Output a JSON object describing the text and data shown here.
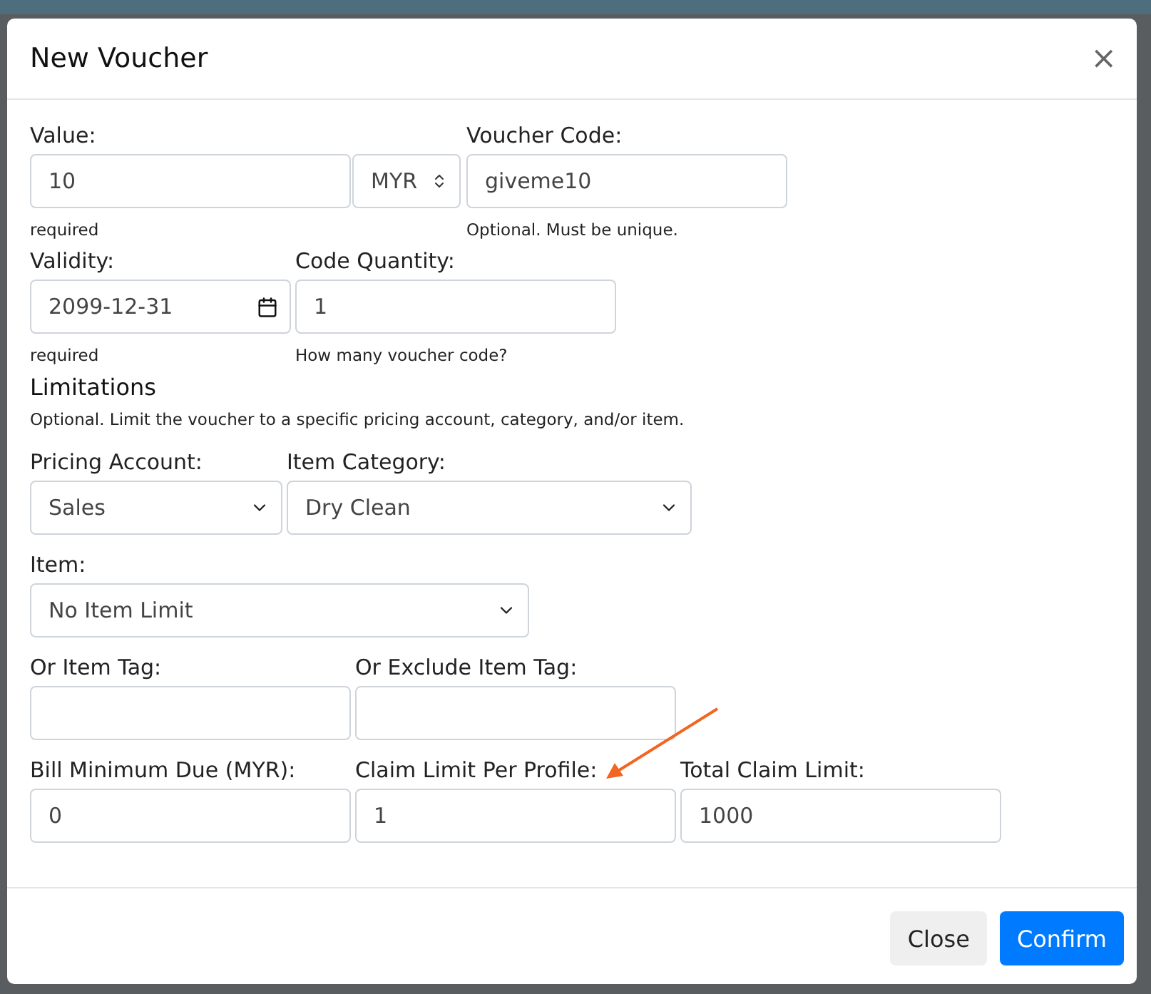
{
  "dialog": {
    "title": "New Voucher",
    "close_glyph": "×"
  },
  "rows": [
    {
      "fields": [
        {
          "label": "Value:",
          "kind": "amount",
          "value": "10",
          "currency": "MYR",
          "hint": "required"
        },
        {
          "label": "Voucher Code:",
          "kind": "text",
          "value": "giveme10",
          "hint": "Optional. Must be unique."
        }
      ]
    },
    {
      "fields": [
        {
          "label": "Validity:",
          "kind": "date",
          "value": "2099-12-31",
          "hint": "required"
        },
        {
          "label": "Code Quantity:",
          "kind": "text",
          "value": "1",
          "hint": "How many voucher code?"
        }
      ]
    },
    {
      "heading": "Limitations",
      "note": "Optional. Limit the voucher to a specific pricing account, category, and/or item.",
      "fields": [
        {
          "label": "Pricing Account:",
          "kind": "select",
          "value": "Sales"
        },
        {
          "label": "Item Category:",
          "kind": "select",
          "value": "Dry Clean"
        }
      ]
    },
    {
      "fields": [
        {
          "label": "Item:",
          "kind": "select",
          "value": "No Item Limit"
        }
      ]
    },
    {
      "fields": [
        {
          "label": "Or Item Tag:",
          "kind": "text"
        },
        {
          "label": "Or Exclude Item Tag:",
          "kind": "text"
        }
      ]
    },
    {
      "fields": [
        {
          "label": "Bill Minimum Due (MYR):",
          "kind": "text",
          "value": "0"
        },
        {
          "label": "Claim Limit Per Profile:",
          "kind": "text",
          "value": "1"
        },
        {
          "label": "Total Claim Limit:",
          "kind": "text",
          "value": "1000"
        }
      ]
    }
  ],
  "buttons": [
    {
      "label": "Close",
      "kind": "secondary"
    },
    {
      "label": "Confirm",
      "kind": "primary"
    }
  ]
}
